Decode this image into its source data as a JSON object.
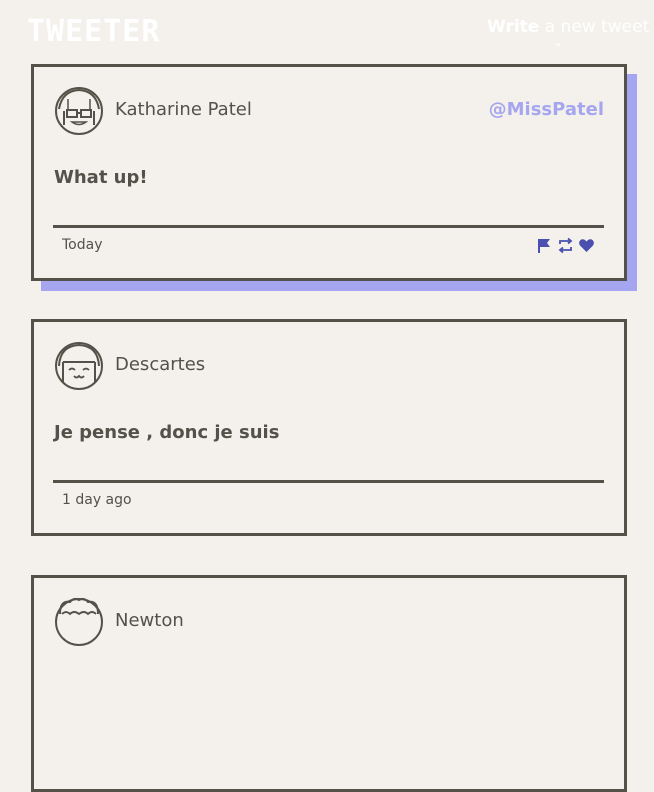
{
  "app": {
    "brand": "TWEETER",
    "compose_bold": "Write",
    "compose_rest": " a new tweet",
    "compose_arrow": "⌄"
  },
  "tweets": [
    {
      "name": "Katharine Patel",
      "handle": "@MissPatel",
      "text": "What up!",
      "time": "Today",
      "avatar": "avatar-sunglasses-icon"
    },
    {
      "name": "Descartes",
      "handle": "",
      "text": "Je pense , donc je suis",
      "time": "1 day ago",
      "avatar": "avatar-happy-icon"
    },
    {
      "name": "Newton",
      "handle": "",
      "text": "",
      "time": "",
      "avatar": "avatar-curly-hair-icon"
    }
  ],
  "colors": {
    "background": "#f4f1ec",
    "ink": "#545149",
    "accent": "#a6a6f0",
    "action_icons": "#4a4fb0"
  },
  "icons": {
    "flag": "flag-icon",
    "retweet": "retweet-icon",
    "like": "heart-icon"
  }
}
